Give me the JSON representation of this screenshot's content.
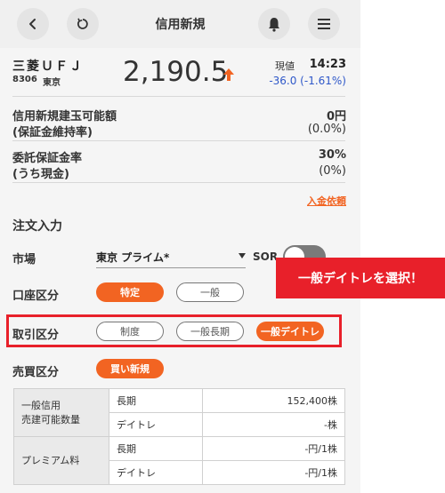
{
  "header": {
    "title": "信用新規"
  },
  "stock": {
    "name": "三菱ＵＦＪ",
    "code": "8306",
    "market": "東京",
    "price": "2,190.5",
    "current_label": "現値",
    "time": "14:23",
    "change": "-36.0 (-1.61%)"
  },
  "margin": {
    "capacity_label": "信用新規建玉可能額",
    "capacity_value": "0円",
    "maintenance_label": "(保証金維持率)",
    "maintenance_value": "(0.0%)",
    "deposit_rate_label": "委託保証金率",
    "deposit_rate_value": "30%",
    "cash_label": "(うち現金)",
    "cash_value": "(0%)",
    "deposit_link": "入金依頼"
  },
  "order": {
    "section_title": "注文入力",
    "market_label": "市場",
    "market_value": "東京 プライム*",
    "sor_label": "SOR",
    "account_label": "口座区分",
    "account_options": [
      "特定",
      "一般"
    ],
    "trade_label": "取引区分",
    "trade_options": [
      "制度",
      "一般長期",
      "一般デイトレ"
    ],
    "side_label": "売買区分",
    "side_value": "買い新規"
  },
  "callout": "一般デイトレを選択！",
  "table": {
    "group1_line1": "一般信用",
    "group1_line2": "売建可能数量",
    "group2": "プレミアム料",
    "rows": [
      {
        "type": "長期",
        "value": "152,400株"
      },
      {
        "type": "デイトレ",
        "value": "-株"
      },
      {
        "type": "長期",
        "value": "-円/1株"
      },
      {
        "type": "デイトレ",
        "value": "-円/1株"
      }
    ]
  },
  "colors": {
    "accent": "#f26422",
    "negative": "#2f58c9",
    "highlight": "#e8202a"
  }
}
